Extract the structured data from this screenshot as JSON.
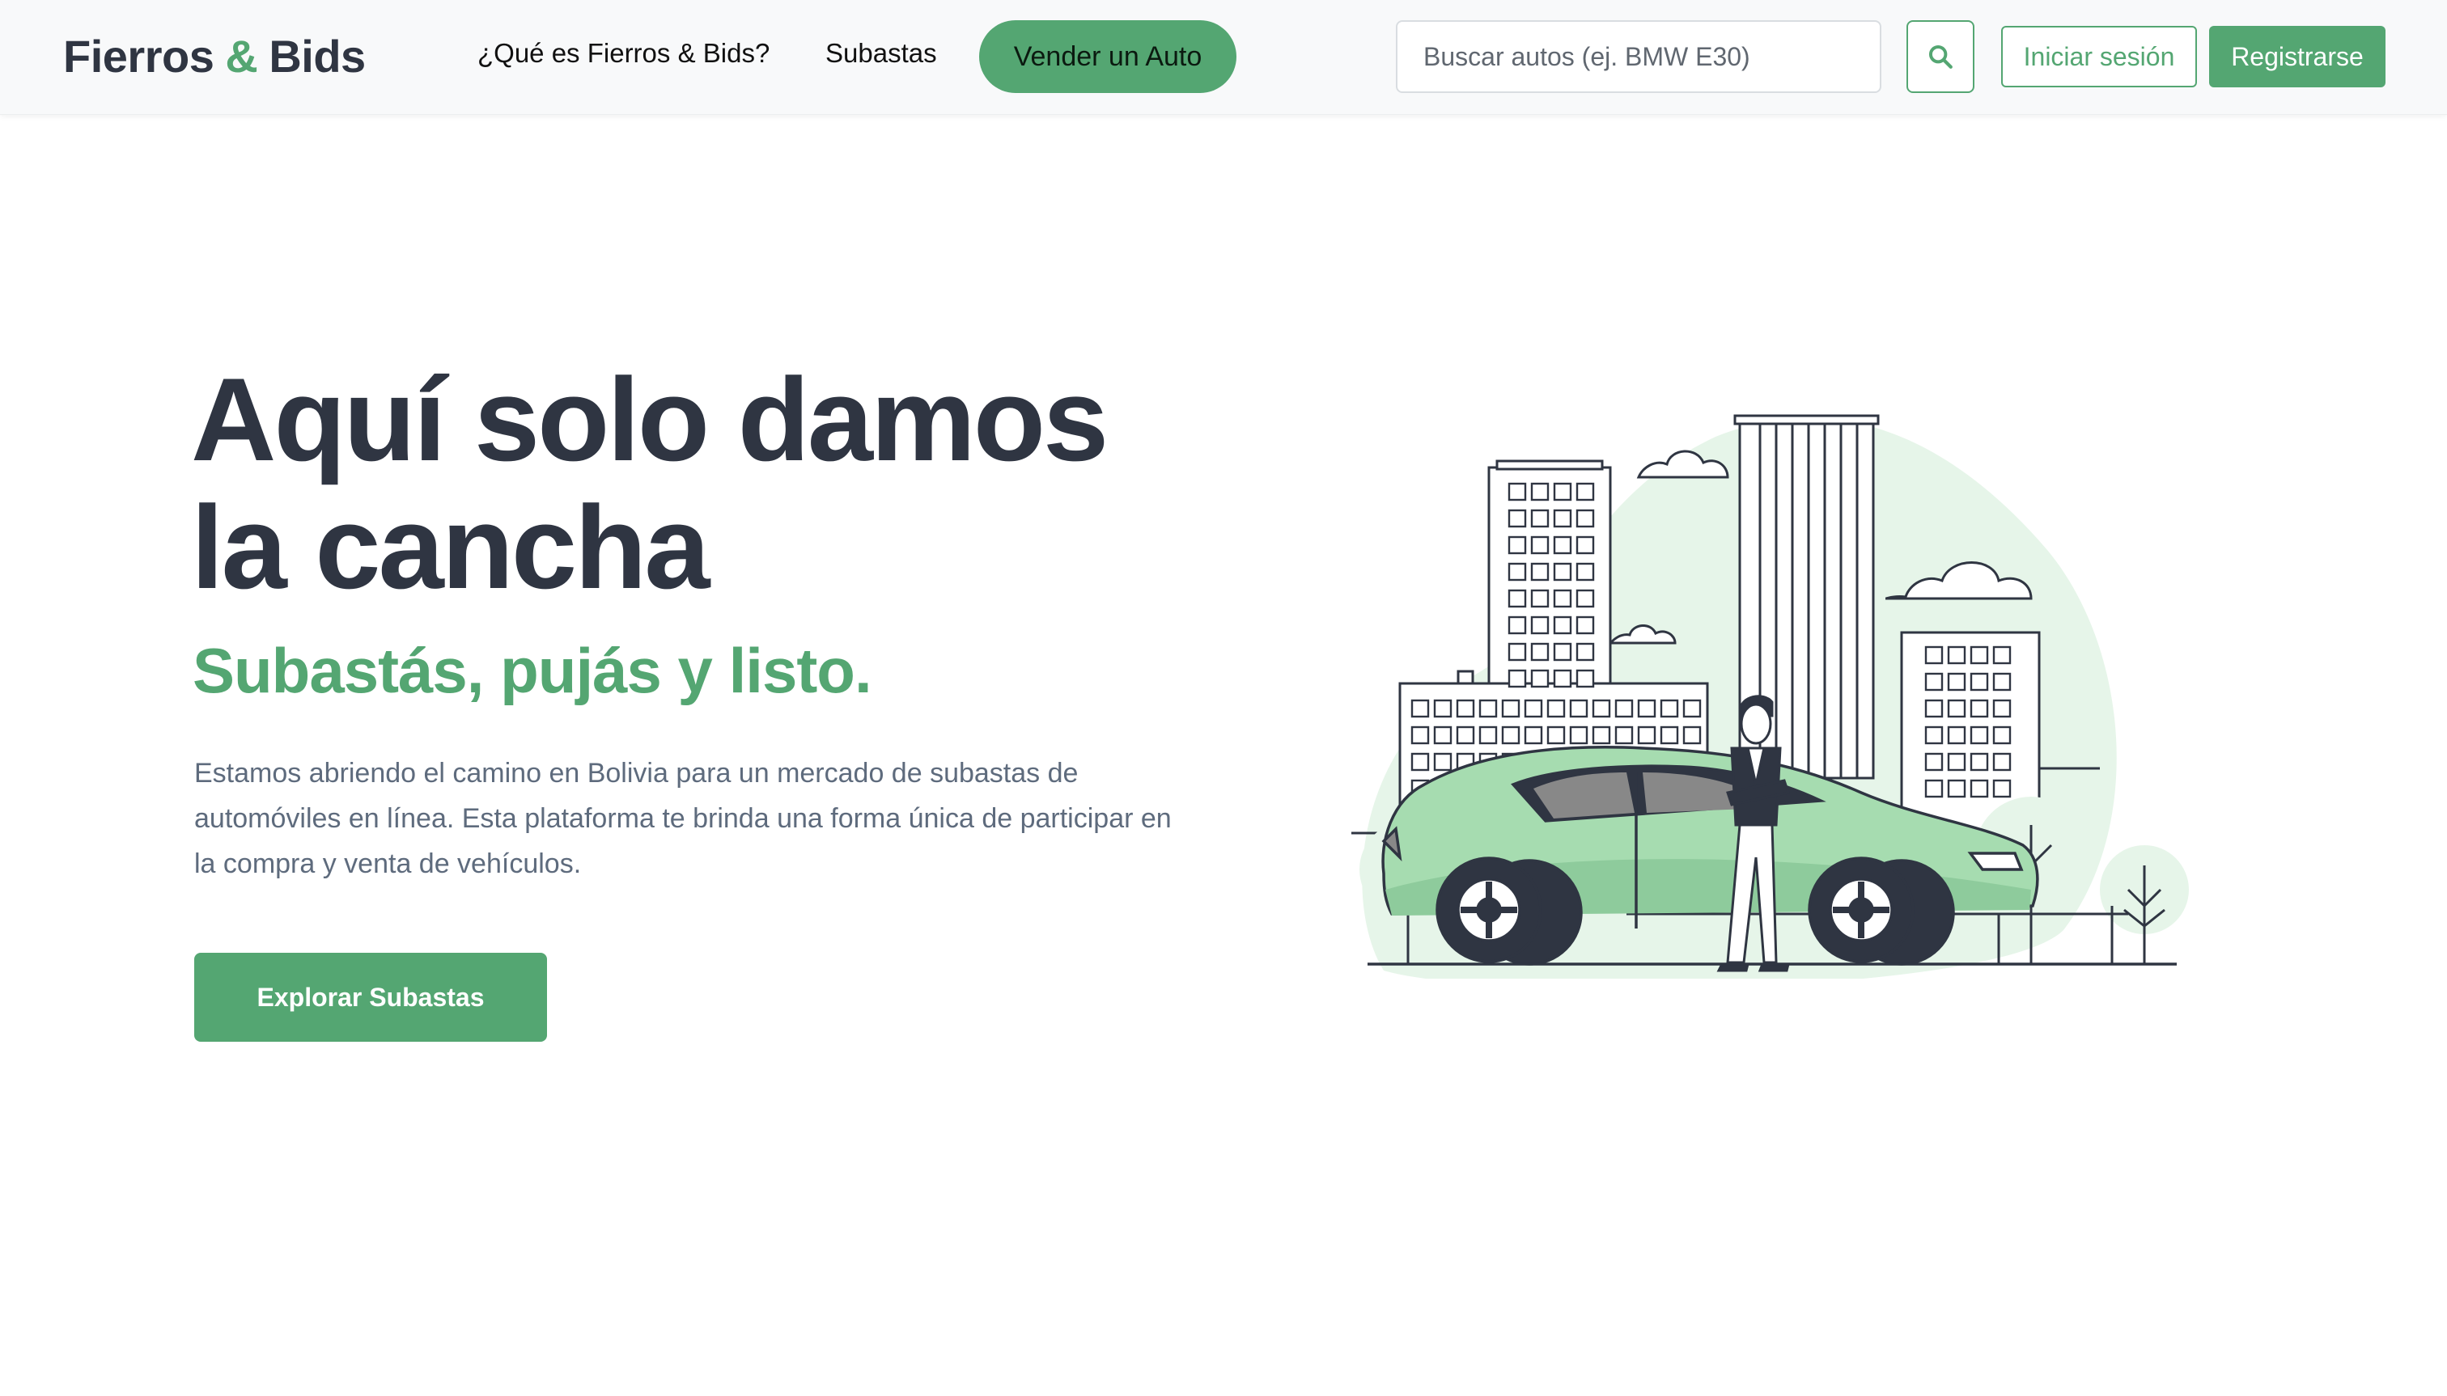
{
  "brand": {
    "name_part1": "Fierros",
    "ampersand": "&",
    "name_part2": "Bids"
  },
  "nav": {
    "about_label": "¿Qué es Fierros & Bids?",
    "auctions_label": "Subastas",
    "sell_label": "Vender un Auto"
  },
  "search": {
    "placeholder": "Buscar autos (ej. BMW E30)",
    "value": "",
    "icon": "search-icon"
  },
  "auth": {
    "login_label": "Iniciar sesión",
    "register_label": "Registrarse"
  },
  "hero": {
    "title_line1": "Aquí solo damos",
    "title_line2": "la cancha",
    "subtitle": "Subastás, pujás y listo.",
    "description": "Estamos abriendo el camino en Bolivia para un mercado de subastas de automóviles en línea. Esta plataforma te brinda una forma única de participar en la compra y venta de vehículos.",
    "cta_label": "Explorar Subastas"
  },
  "colors": {
    "accent": "#54a672",
    "text_dark": "#2f3542",
    "text_muted": "#5e6b7d",
    "illustration_fill": "#a6dcb0",
    "illustration_bg": "#e6f5e9"
  }
}
